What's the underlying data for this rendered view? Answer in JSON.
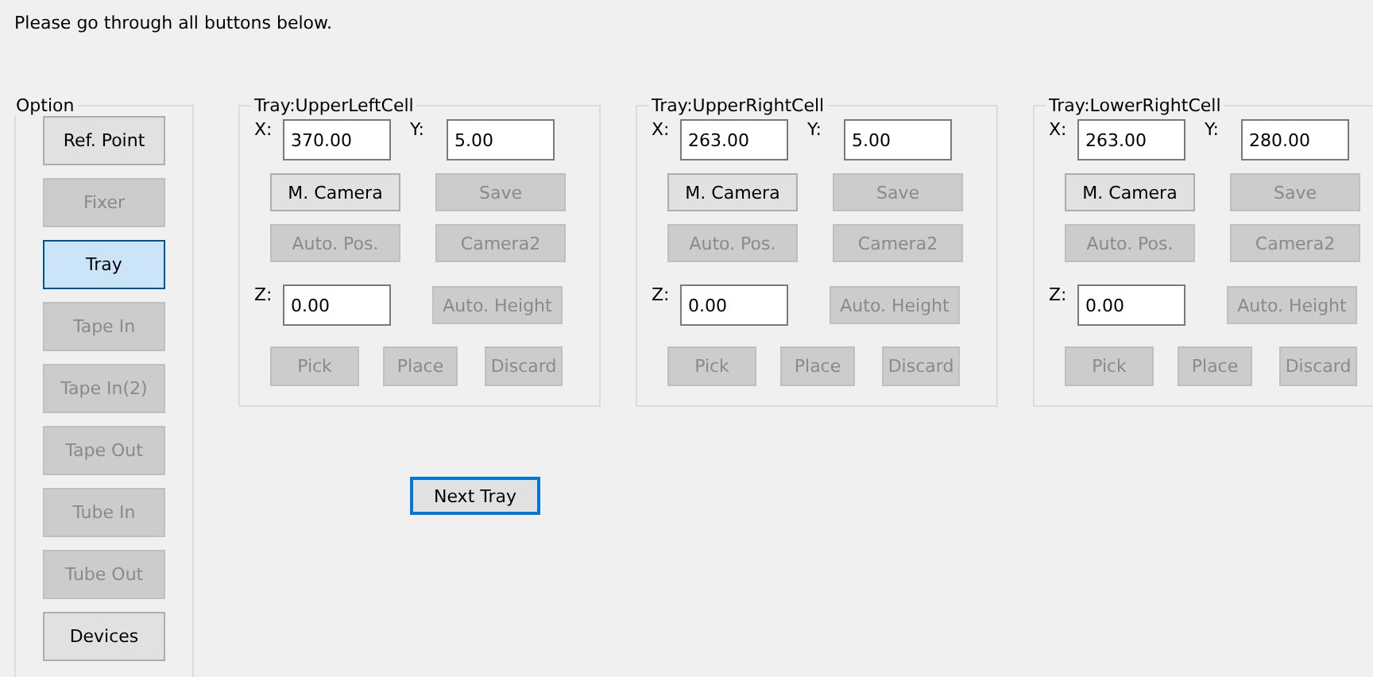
{
  "instruction": "Please go through all buttons below.",
  "option_group": {
    "title": "Option",
    "buttons": [
      {
        "label": "Ref. Point",
        "disabled": false,
        "selected": false
      },
      {
        "label": "Fixer",
        "disabled": true,
        "selected": false
      },
      {
        "label": "Tray",
        "disabled": false,
        "selected": true
      },
      {
        "label": "Tape In",
        "disabled": true,
        "selected": false
      },
      {
        "label": "Tape In(2)",
        "disabled": true,
        "selected": false
      },
      {
        "label": "Tape Out",
        "disabled": true,
        "selected": false
      },
      {
        "label": "Tube In",
        "disabled": true,
        "selected": false
      },
      {
        "label": "Tube Out",
        "disabled": true,
        "selected": false
      },
      {
        "label": "Devices",
        "disabled": false,
        "selected": false
      }
    ]
  },
  "tray_groups": [
    {
      "title": "Tray:UpperLeftCell",
      "x_label": "X:",
      "x_value": "370.00",
      "y_label": "Y:",
      "y_value": "5.00",
      "z_label": "Z:",
      "z_value": "0.00",
      "buttons": [
        {
          "label": "M. Camera",
          "disabled": false
        },
        {
          "label": "Save",
          "disabled": true
        },
        {
          "label": "Auto. Pos.",
          "disabled": true
        },
        {
          "label": "Camera2",
          "disabled": true
        },
        {
          "label": "Auto. Height",
          "disabled": true
        },
        {
          "label": "Pick",
          "disabled": true
        },
        {
          "label": "Place",
          "disabled": true
        },
        {
          "label": "Discard",
          "disabled": true
        }
      ]
    },
    {
      "title": "Tray:UpperRightCell",
      "x_label": "X:",
      "x_value": "263.00",
      "y_label": "Y:",
      "y_value": "5.00",
      "z_label": "Z:",
      "z_value": "0.00",
      "buttons": [
        {
          "label": "M. Camera",
          "disabled": false
        },
        {
          "label": "Save",
          "disabled": true
        },
        {
          "label": "Auto. Pos.",
          "disabled": true
        },
        {
          "label": "Camera2",
          "disabled": true
        },
        {
          "label": "Auto. Height",
          "disabled": true
        },
        {
          "label": "Pick",
          "disabled": true
        },
        {
          "label": "Place",
          "disabled": true
        },
        {
          "label": "Discard",
          "disabled": true
        }
      ]
    },
    {
      "title": "Tray:LowerRightCell",
      "x_label": "X:",
      "x_value": "263.00",
      "y_label": "Y:",
      "y_value": "280.00",
      "z_label": "Z:",
      "z_value": "0.00",
      "buttons": [
        {
          "label": "M. Camera",
          "disabled": false
        },
        {
          "label": "Save",
          "disabled": true
        },
        {
          "label": "Auto. Pos.",
          "disabled": true
        },
        {
          "label": "Camera2",
          "disabled": true
        },
        {
          "label": "Auto. Height",
          "disabled": true
        },
        {
          "label": "Pick",
          "disabled": true
        },
        {
          "label": "Place",
          "disabled": true
        },
        {
          "label": "Discard",
          "disabled": true
        }
      ]
    }
  ],
  "next_button": {
    "label": "Next Tray",
    "focused": true
  }
}
